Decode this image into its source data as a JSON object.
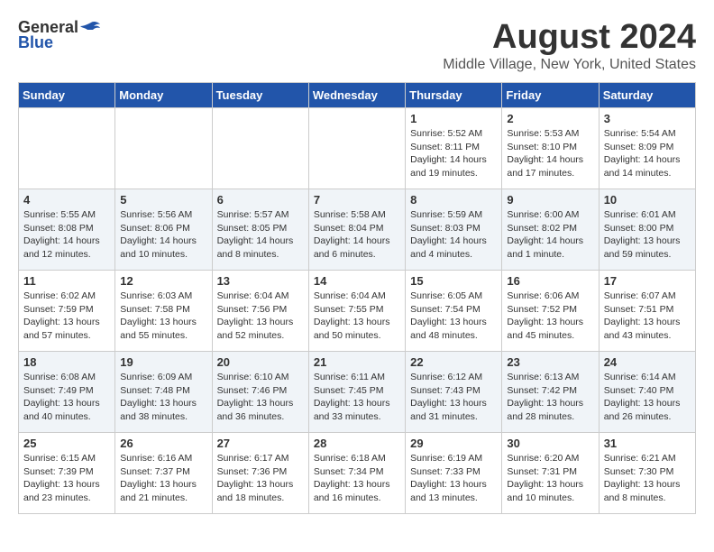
{
  "header": {
    "logo_general": "General",
    "logo_blue": "Blue",
    "month_title": "August 2024",
    "location": "Middle Village, New York, United States"
  },
  "days_of_week": [
    "Sunday",
    "Monday",
    "Tuesday",
    "Wednesday",
    "Thursday",
    "Friday",
    "Saturday"
  ],
  "weeks": [
    [
      {
        "day": "",
        "info": ""
      },
      {
        "day": "",
        "info": ""
      },
      {
        "day": "",
        "info": ""
      },
      {
        "day": "",
        "info": ""
      },
      {
        "day": "1",
        "info": "Sunrise: 5:52 AM\nSunset: 8:11 PM\nDaylight: 14 hours\nand 19 minutes."
      },
      {
        "day": "2",
        "info": "Sunrise: 5:53 AM\nSunset: 8:10 PM\nDaylight: 14 hours\nand 17 minutes."
      },
      {
        "day": "3",
        "info": "Sunrise: 5:54 AM\nSunset: 8:09 PM\nDaylight: 14 hours\nand 14 minutes."
      }
    ],
    [
      {
        "day": "4",
        "info": "Sunrise: 5:55 AM\nSunset: 8:08 PM\nDaylight: 14 hours\nand 12 minutes."
      },
      {
        "day": "5",
        "info": "Sunrise: 5:56 AM\nSunset: 8:06 PM\nDaylight: 14 hours\nand 10 minutes."
      },
      {
        "day": "6",
        "info": "Sunrise: 5:57 AM\nSunset: 8:05 PM\nDaylight: 14 hours\nand 8 minutes."
      },
      {
        "day": "7",
        "info": "Sunrise: 5:58 AM\nSunset: 8:04 PM\nDaylight: 14 hours\nand 6 minutes."
      },
      {
        "day": "8",
        "info": "Sunrise: 5:59 AM\nSunset: 8:03 PM\nDaylight: 14 hours\nand 4 minutes."
      },
      {
        "day": "9",
        "info": "Sunrise: 6:00 AM\nSunset: 8:02 PM\nDaylight: 14 hours\nand 1 minute."
      },
      {
        "day": "10",
        "info": "Sunrise: 6:01 AM\nSunset: 8:00 PM\nDaylight: 13 hours\nand 59 minutes."
      }
    ],
    [
      {
        "day": "11",
        "info": "Sunrise: 6:02 AM\nSunset: 7:59 PM\nDaylight: 13 hours\nand 57 minutes."
      },
      {
        "day": "12",
        "info": "Sunrise: 6:03 AM\nSunset: 7:58 PM\nDaylight: 13 hours\nand 55 minutes."
      },
      {
        "day": "13",
        "info": "Sunrise: 6:04 AM\nSunset: 7:56 PM\nDaylight: 13 hours\nand 52 minutes."
      },
      {
        "day": "14",
        "info": "Sunrise: 6:04 AM\nSunset: 7:55 PM\nDaylight: 13 hours\nand 50 minutes."
      },
      {
        "day": "15",
        "info": "Sunrise: 6:05 AM\nSunset: 7:54 PM\nDaylight: 13 hours\nand 48 minutes."
      },
      {
        "day": "16",
        "info": "Sunrise: 6:06 AM\nSunset: 7:52 PM\nDaylight: 13 hours\nand 45 minutes."
      },
      {
        "day": "17",
        "info": "Sunrise: 6:07 AM\nSunset: 7:51 PM\nDaylight: 13 hours\nand 43 minutes."
      }
    ],
    [
      {
        "day": "18",
        "info": "Sunrise: 6:08 AM\nSunset: 7:49 PM\nDaylight: 13 hours\nand 40 minutes."
      },
      {
        "day": "19",
        "info": "Sunrise: 6:09 AM\nSunset: 7:48 PM\nDaylight: 13 hours\nand 38 minutes."
      },
      {
        "day": "20",
        "info": "Sunrise: 6:10 AM\nSunset: 7:46 PM\nDaylight: 13 hours\nand 36 minutes."
      },
      {
        "day": "21",
        "info": "Sunrise: 6:11 AM\nSunset: 7:45 PM\nDaylight: 13 hours\nand 33 minutes."
      },
      {
        "day": "22",
        "info": "Sunrise: 6:12 AM\nSunset: 7:43 PM\nDaylight: 13 hours\nand 31 minutes."
      },
      {
        "day": "23",
        "info": "Sunrise: 6:13 AM\nSunset: 7:42 PM\nDaylight: 13 hours\nand 28 minutes."
      },
      {
        "day": "24",
        "info": "Sunrise: 6:14 AM\nSunset: 7:40 PM\nDaylight: 13 hours\nand 26 minutes."
      }
    ],
    [
      {
        "day": "25",
        "info": "Sunrise: 6:15 AM\nSunset: 7:39 PM\nDaylight: 13 hours\nand 23 minutes."
      },
      {
        "day": "26",
        "info": "Sunrise: 6:16 AM\nSunset: 7:37 PM\nDaylight: 13 hours\nand 21 minutes."
      },
      {
        "day": "27",
        "info": "Sunrise: 6:17 AM\nSunset: 7:36 PM\nDaylight: 13 hours\nand 18 minutes."
      },
      {
        "day": "28",
        "info": "Sunrise: 6:18 AM\nSunset: 7:34 PM\nDaylight: 13 hours\nand 16 minutes."
      },
      {
        "day": "29",
        "info": "Sunrise: 6:19 AM\nSunset: 7:33 PM\nDaylight: 13 hours\nand 13 minutes."
      },
      {
        "day": "30",
        "info": "Sunrise: 6:20 AM\nSunset: 7:31 PM\nDaylight: 13 hours\nand 10 minutes."
      },
      {
        "day": "31",
        "info": "Sunrise: 6:21 AM\nSunset: 7:30 PM\nDaylight: 13 hours\nand 8 minutes."
      }
    ]
  ]
}
